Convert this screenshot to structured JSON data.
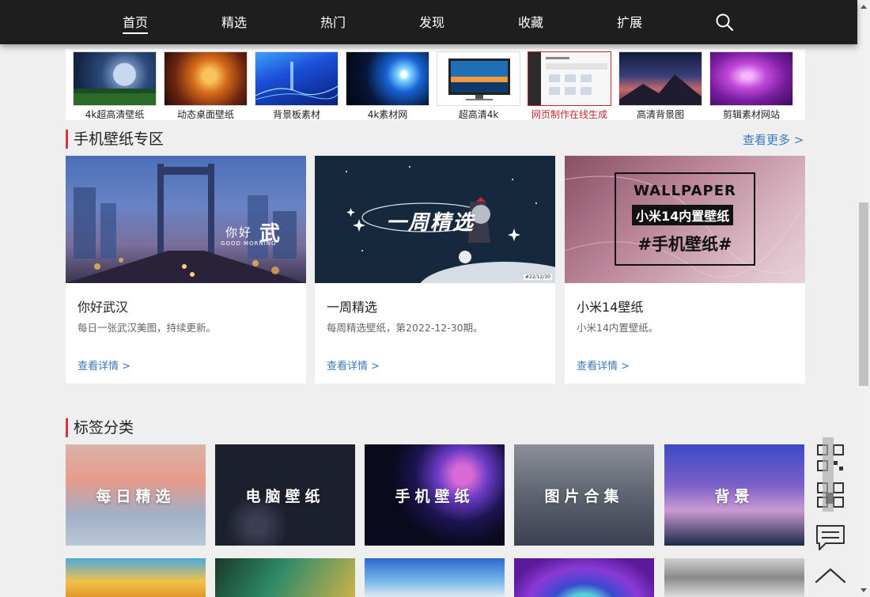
{
  "nav": {
    "items": [
      "首页",
      "精选",
      "热门",
      "发现",
      "收藏",
      "扩展"
    ],
    "search_icon": "search-icon"
  },
  "strip": {
    "items": [
      {
        "label": "4k超高清壁纸"
      },
      {
        "label": "动态桌面壁纸"
      },
      {
        "label": "背景板素材"
      },
      {
        "label": "4k素材网"
      },
      {
        "label": "超高清4k"
      },
      {
        "label": "网页制作在线生成"
      },
      {
        "label": "高清背景图"
      },
      {
        "label": "剪辑素材网站"
      }
    ]
  },
  "mobile_section": {
    "title": "手机壁纸专区",
    "more": "查看更多 >",
    "cards": [
      {
        "title": "你好武汉",
        "desc": "每日一张武汉美图，持续更新。",
        "link": "查看详情 >",
        "img_text": "你好",
        "img_text2": "GOOD MORNING",
        "img_text3": "武"
      },
      {
        "title": "一周精选",
        "desc": "每周精选壁纸，第2022-12-30期。",
        "link": "查看详情 >",
        "img_text": "一周精选",
        "img_text2": "#22/12/30"
      },
      {
        "title": "小米14壁纸",
        "desc": "小米14内置壁纸。",
        "link": "查看详情 >",
        "img_text": "WALLPAPER",
        "img_text2": "小米14内置壁纸",
        "img_text3": "#手机壁纸#"
      }
    ]
  },
  "tags_section": {
    "title": "标签分类",
    "row1": [
      {
        "label": "每日精选"
      },
      {
        "label": "电脑壁纸"
      },
      {
        "label": "手机壁纸"
      },
      {
        "label": "图片合集"
      },
      {
        "label": "背景"
      }
    ]
  },
  "float_tools": {
    "qr_icon": "qr-code-icon",
    "comment_icon": "comment-icon",
    "top_icon": "back-to-top-icon"
  }
}
